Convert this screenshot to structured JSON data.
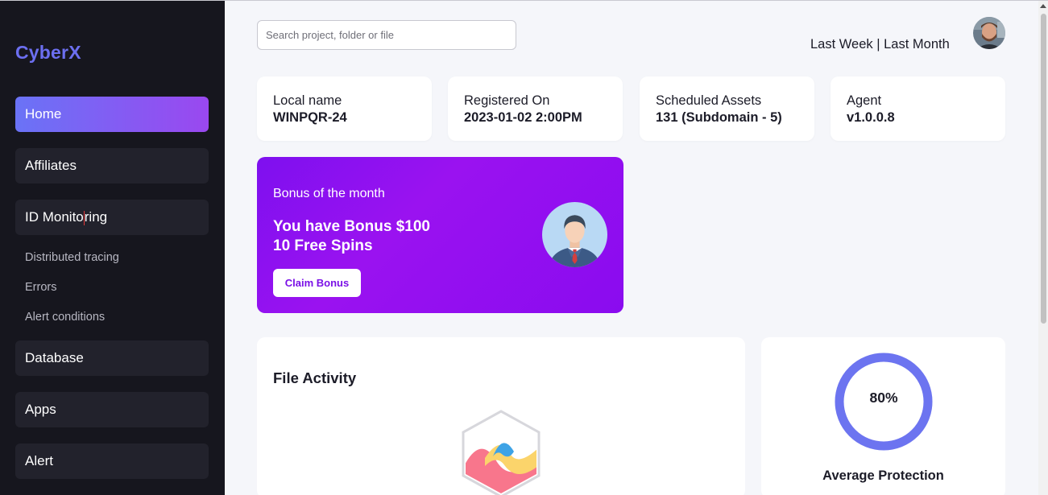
{
  "app": {
    "logo": "CyberX"
  },
  "sidebar": {
    "items": [
      {
        "label": "Home",
        "active": true
      },
      {
        "label": "Affiliates"
      },
      {
        "label": "ID Monitoring",
        "label_a": "ID Monito",
        "label_b": "ring"
      },
      {
        "label": "Database"
      },
      {
        "label": "Apps"
      },
      {
        "label": "Alert"
      }
    ],
    "subitems": [
      "Distributed tracing",
      "Errors",
      "Alert conditions"
    ]
  },
  "search": {
    "placeholder": "Search project, folder or file"
  },
  "period": {
    "last_week": "Last Week",
    "separator": " | ",
    "last_month": "Last Month"
  },
  "info_cards": [
    {
      "label": "Local name",
      "value": "WINPQR-24"
    },
    {
      "label": "Registered On",
      "value": "2023-01-02 2:00PM"
    },
    {
      "label": "Scheduled Assets",
      "value": "131 (Subdomain - 5)"
    },
    {
      "label": "Agent",
      "value": "v1.0.0.8"
    }
  ],
  "bonus": {
    "title": "Bonus of the month",
    "line1": "You have Bonus $100",
    "line2": "10 Free Spins",
    "button": "Claim Bonus"
  },
  "file_activity": {
    "title": "File Activity"
  },
  "protection": {
    "percent_text": "80%",
    "value": 0.8,
    "caption": "Average Protection"
  },
  "colors": {
    "accent": "#6c6ff0",
    "bonus_purple": "#8a0bef",
    "ring": "#6c74f0",
    "sidebar_bg": "#16161e"
  }
}
